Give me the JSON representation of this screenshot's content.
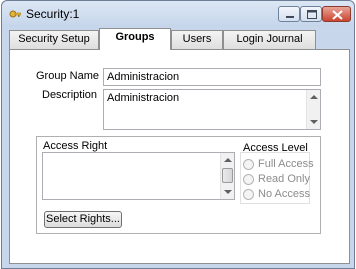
{
  "window": {
    "title": "Security:1",
    "icons": [
      "app-key-icon",
      "minimize-icon",
      "maximize-icon",
      "close-icon"
    ]
  },
  "tabs": [
    {
      "label": "Security Setup",
      "active": false
    },
    {
      "label": "Groups",
      "active": true
    },
    {
      "label": "Users",
      "active": false
    },
    {
      "label": "Login Journal",
      "active": false
    }
  ],
  "form": {
    "group_name_label": "Group Name",
    "group_name_value": "Administracion",
    "description_label": "Description",
    "description_value": "Administracion"
  },
  "access": {
    "access_right_label": "Access Right",
    "access_level_label": "Access Level",
    "levels": [
      "Full Access",
      "Read Only",
      "No Access"
    ],
    "select_rights_label": "Select Rights..."
  }
}
